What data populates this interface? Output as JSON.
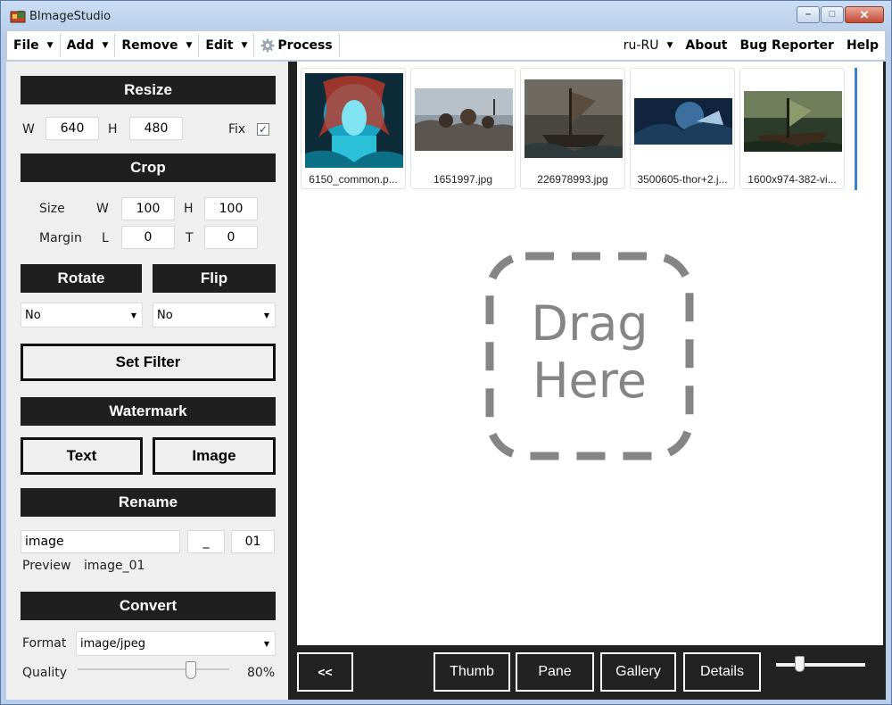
{
  "window": {
    "title": "BImageStudio"
  },
  "menu": {
    "file": "File",
    "add": "Add",
    "remove": "Remove",
    "edit": "Edit",
    "process": "Process",
    "language": "ru-RU",
    "about": "About",
    "bug_reporter": "Bug Reporter",
    "help": "Help"
  },
  "resize": {
    "header": "Resize",
    "w_label": "W",
    "w_value": "640",
    "h_label": "H",
    "h_value": "480",
    "fix_label": "Fix",
    "fix_checked": true
  },
  "crop": {
    "header": "Crop",
    "size_label": "Size",
    "w_label": "W",
    "w_value": "100",
    "h_label": "H",
    "h_value": "100",
    "margin_label": "Margin",
    "l_label": "L",
    "l_value": "0",
    "t_label": "T",
    "t_value": "0"
  },
  "rotate": {
    "header": "Rotate",
    "value": "No"
  },
  "flip": {
    "header": "Flip",
    "value": "No"
  },
  "filter": {
    "button": "Set Filter"
  },
  "watermark": {
    "header": "Watermark",
    "text_button": "Text",
    "image_button": "Image"
  },
  "rename": {
    "header": "Rename",
    "name_value": "image",
    "separator_value": "_",
    "start_value": "01",
    "preview_label": "Preview",
    "preview_value": "image_01"
  },
  "convert": {
    "header": "Convert",
    "format_label": "Format",
    "format_value": "image/jpeg",
    "quality_label": "Quality",
    "quality_value": "80%",
    "quality_fraction": 0.8
  },
  "thumbnails": [
    {
      "caption": "6150_common.p..."
    },
    {
      "caption": "1651997.jpg"
    },
    {
      "caption": "226978993.jpg"
    },
    {
      "caption": "3500605-thor+2.j..."
    },
    {
      "caption": "1600x974-382-vi..."
    }
  ],
  "drop_zone": {
    "line1": "Drag",
    "line2": "Here"
  },
  "bottom_bar": {
    "back": "<<",
    "thumb": "Thumb",
    "pane": "Pane",
    "gallery": "Gallery",
    "details": "Details"
  },
  "colors": {
    "panel_dark": "#1f1f1f",
    "selection": "#3b82d9",
    "drop_text": "#858585"
  }
}
